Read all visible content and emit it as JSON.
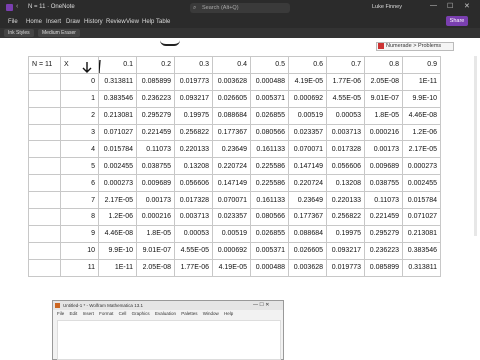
{
  "window": {
    "title": "N = 11  ·  OneNote",
    "search_placeholder": "Search (Alt+Q)",
    "user": "Luke Finney",
    "minimize": "—",
    "maximize": "☐",
    "close": "✕"
  },
  "menu": [
    "File",
    "Home",
    "Insert",
    "Draw",
    "History",
    "Review",
    "View",
    "Help",
    "Table"
  ],
  "share_label": "Share",
  "ribbon": {
    "ink_styles": "Ink Styles",
    "pen": "Medium Eraser"
  },
  "notebook_tag": "Numerade > Problems",
  "table": {
    "header": [
      "N = 11",
      "X",
      "0.1",
      "0.2",
      "0.3",
      "0.4",
      "0.5",
      "0.6",
      "0.7",
      "0.8",
      "0.9"
    ],
    "rows": [
      [
        "",
        "0",
        "0.313811",
        "0.085899",
        "0.019773",
        "0.003628",
        "0.000488",
        "4.19E-05",
        "1.77E-06",
        "2.05E-08",
        "1E-11"
      ],
      [
        "",
        "1",
        "0.383546",
        "0.236223",
        "0.093217",
        "0.026605",
        "0.005371",
        "0.000692",
        "4.55E-05",
        "9.01E-07",
        "9.9E-10"
      ],
      [
        "",
        "2",
        "0.213081",
        "0.295279",
        "0.19975",
        "0.088684",
        "0.026855",
        "0.00519",
        "0.00053",
        "1.8E-05",
        "4.46E-08"
      ],
      [
        "",
        "3",
        "0.071027",
        "0.221459",
        "0.256822",
        "0.177367",
        "0.080566",
        "0.023357",
        "0.003713",
        "0.000216",
        "1.2E-06"
      ],
      [
        "",
        "4",
        "0.015784",
        "0.11073",
        "0.220133",
        "0.23649",
        "0.161133",
        "0.070071",
        "0.017328",
        "0.00173",
        "2.17E-05"
      ],
      [
        "",
        "5",
        "0.002455",
        "0.038755",
        "0.13208",
        "0.220724",
        "0.225586",
        "0.147149",
        "0.056606",
        "0.009689",
        "0.000273"
      ],
      [
        "",
        "6",
        "0.000273",
        "0.009689",
        "0.056606",
        "0.147149",
        "0.225586",
        "0.220724",
        "0.13208",
        "0.038755",
        "0.002455"
      ],
      [
        "",
        "7",
        "2.17E-05",
        "0.00173",
        "0.017328",
        "0.070071",
        "0.161133",
        "0.23649",
        "0.220133",
        "0.11073",
        "0.015784"
      ],
      [
        "",
        "8",
        "1.2E-06",
        "0.000216",
        "0.003713",
        "0.023357",
        "0.080566",
        "0.177367",
        "0.256822",
        "0.221459",
        "0.071027"
      ],
      [
        "",
        "9",
        "4.46E-08",
        "1.8E-05",
        "0.00053",
        "0.00519",
        "0.026855",
        "0.088684",
        "0.19975",
        "0.295279",
        "0.213081"
      ],
      [
        "",
        "10",
        "9.9E-10",
        "9.01E-07",
        "4.55E-05",
        "0.000692",
        "0.005371",
        "0.026605",
        "0.093217",
        "0.236223",
        "0.383546"
      ],
      [
        "",
        "11",
        "1E-11",
        "2.05E-08",
        "1.77E-06",
        "4.19E-05",
        "0.000488",
        "0.003628",
        "0.019773",
        "0.085899",
        "0.313811"
      ]
    ]
  },
  "mathematica": {
    "title": "Untitled-1 * - Wolfram Mathematica 13.1",
    "menu": [
      "File",
      "Edit",
      "Insert",
      "Format",
      "Cell",
      "Graphics",
      "Evaluation",
      "Palettes",
      "Window",
      "Help"
    ],
    "controls": "—  ☐  ✕"
  }
}
